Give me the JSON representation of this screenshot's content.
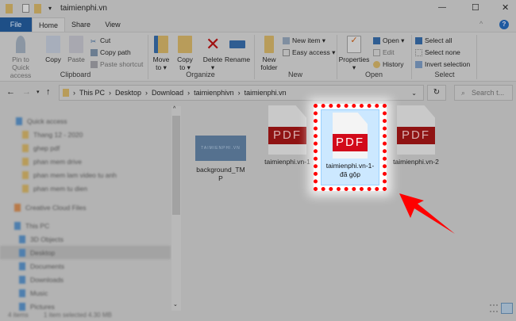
{
  "window": {
    "title": "taimienphi.vn",
    "minimize": "—",
    "maximize": "☐",
    "close": "✕"
  },
  "tabs": [
    {
      "label": "File"
    },
    {
      "label": "Home"
    },
    {
      "label": "Share"
    },
    {
      "label": "View"
    }
  ],
  "ribbon": {
    "clipboard": {
      "label": "Clipboard",
      "pin": "Pin to Quick access",
      "copy": "Copy",
      "paste": "Paste",
      "cut": "Cut",
      "copy_path": "Copy path",
      "paste_shortcut": "Paste shortcut"
    },
    "organize": {
      "label": "Organize",
      "move_to": "Move to ▾",
      "copy_to": "Copy to ▾",
      "delete": "Delete ▾",
      "rename": "Rename"
    },
    "new": {
      "label": "New",
      "new_folder": "New folder",
      "new_item": "New item ▾",
      "easy_access": "Easy access ▾"
    },
    "open": {
      "label": "Open",
      "properties": "Properties ▾",
      "open": "Open ▾",
      "edit": "Edit",
      "history": "History"
    },
    "select": {
      "label": "Select",
      "select_all": "Select all",
      "select_none": "Select none",
      "invert": "Invert selection"
    }
  },
  "address": {
    "crumbs": [
      "This PC",
      "Desktop",
      "Download",
      "taimienphivn",
      "taimienphi.vn"
    ],
    "search_placeholder": "Search t..."
  },
  "nav": {
    "items": [
      "Quick access",
      "Thang 12 - 2020",
      "ghep pdf",
      "phan mem drive",
      "phan mem lam video tu anh",
      "phan mem tu dien",
      "Creative Cloud Files",
      "This PC",
      "3D Objects",
      "Desktop",
      "Documents",
      "Downloads",
      "Music",
      "Pictures"
    ]
  },
  "files": [
    {
      "name": "background_TMP",
      "thumb_text": "TAIMIENPHI.VN"
    },
    {
      "name": "taimienphi.vn-1",
      "badge": "PDF"
    },
    {
      "name": "taimienphi.vn-1-đã gộp",
      "badge": "PDF",
      "selected": true
    },
    {
      "name": "taimienphi.vn-2",
      "badge": "PDF"
    }
  ],
  "status": {
    "count": "4 items",
    "selected": "1 item selected  4.30 MB"
  },
  "colors": {
    "highlight": "#ff0000",
    "selection": "#cce8ff",
    "pdf_red": "#d20a1a"
  }
}
